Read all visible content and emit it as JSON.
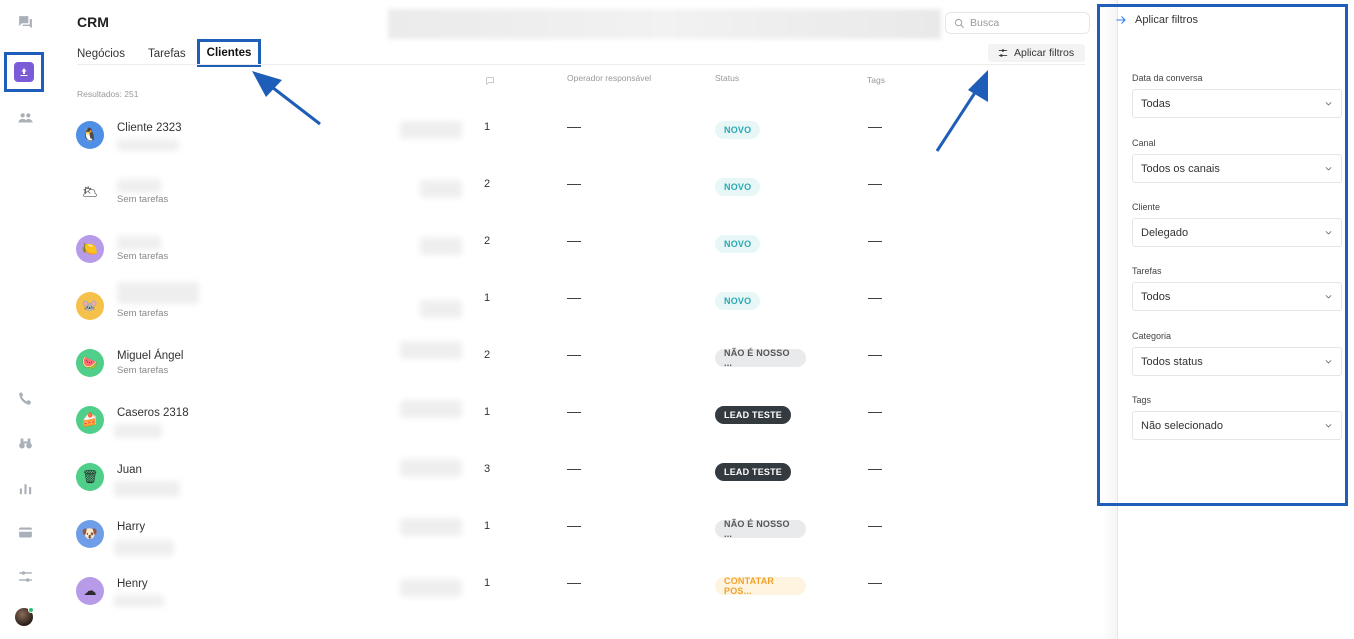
{
  "app": {
    "title": "CRM"
  },
  "tabs": [
    {
      "label": "Negócios",
      "active": false
    },
    {
      "label": "Tarefas",
      "active": false
    },
    {
      "label": "Clientes",
      "active": true
    }
  ],
  "search": {
    "placeholder": "Busca"
  },
  "toolbar": {
    "apply_filters_label": "Aplicar filtros"
  },
  "table": {
    "results_label": "Resultados: 251",
    "columns": {
      "messages_icon": "chat-bubble-icon",
      "operator": "Operador responsável",
      "status": "Status",
      "tags": "Tags"
    },
    "rows": [
      {
        "name": "Cliente 2323",
        "subtitle": "",
        "avatar_icon": "penguin-icon",
        "avatar_color": "#4f8fe6",
        "count": "1",
        "operator": "—",
        "status": "NOVO",
        "status_kind": "novo",
        "tags": "—"
      },
      {
        "name": "",
        "subtitle": "Sem tarefas",
        "avatar_icon": "cloud-icon",
        "avatar_color": "#ffffff",
        "count": "2",
        "operator": "—",
        "status": "NOVO",
        "status_kind": "novo",
        "tags": "—"
      },
      {
        "name": "",
        "subtitle": "Sem tarefas",
        "avatar_icon": "lemon-icon",
        "avatar_color": "#b79ae8",
        "count": "2",
        "operator": "—",
        "status": "NOVO",
        "status_kind": "novo",
        "tags": "—"
      },
      {
        "name": "",
        "subtitle": "Sem tarefas",
        "avatar_icon": "mouse-icon",
        "avatar_color": "#f6c14a",
        "count": "1",
        "operator": "—",
        "status": "NOVO",
        "status_kind": "novo",
        "tags": "—"
      },
      {
        "name": "Miguel Ángel",
        "subtitle": "Sem tarefas",
        "avatar_icon": "watermelon-icon",
        "avatar_color": "#4fcf8a",
        "count": "2",
        "operator": "—",
        "status": "NÃO É NOSSO ...",
        "status_kind": "nao",
        "tags": "—"
      },
      {
        "name": "Caseros 2318",
        "subtitle": "",
        "avatar_icon": "cake-icon",
        "avatar_color": "#4fcf8a",
        "count": "1",
        "operator": "—",
        "status": "LEAD TESTE",
        "status_kind": "lead",
        "tags": "—"
      },
      {
        "name": "Juan",
        "subtitle": "",
        "avatar_icon": "trash-can-icon",
        "avatar_color": "#4fcf8a",
        "count": "3",
        "operator": "—",
        "status": "LEAD TESTE",
        "status_kind": "lead",
        "tags": "—"
      },
      {
        "name": "Harry",
        "subtitle": "",
        "avatar_icon": "dog-icon",
        "avatar_color": "#6e9ee8",
        "count": "1",
        "operator": "—",
        "status": "NÃO É NOSSO ...",
        "status_kind": "nao",
        "tags": "—"
      },
      {
        "name": "Henry",
        "subtitle": "",
        "avatar_icon": "cloud-icon",
        "avatar_color": "#b79ae8",
        "count": "1",
        "operator": "—",
        "status": "CONTATAR POS...",
        "status_kind": "contatar",
        "tags": "—"
      }
    ]
  },
  "filters": {
    "title": "Aplicar filtros",
    "groups": [
      {
        "label": "Data da conversa",
        "value": "Todas"
      },
      {
        "label": "Canal",
        "value": "Todos os canais"
      },
      {
        "label": "Cliente",
        "value": "Delegado"
      },
      {
        "label": "Tarefas",
        "value": "Todos"
      },
      {
        "label": "Categoria",
        "value": "Todos status"
      },
      {
        "label": "Tags",
        "value": "Não selecionado"
      }
    ]
  },
  "sidebar": {
    "items": [
      {
        "icon": "chat-icon"
      },
      {
        "icon": "crm-icon",
        "active": true
      },
      {
        "icon": "users-icon"
      },
      {
        "icon": "phone-icon"
      },
      {
        "icon": "binoculars-icon"
      },
      {
        "icon": "bar-chart-icon"
      },
      {
        "icon": "card-icon"
      },
      {
        "icon": "settings-sliders-icon"
      }
    ]
  },
  "colors": {
    "accent": "#2a7de1",
    "annotation": "#1e5eb8",
    "crm_active": "#7b5bd6"
  }
}
